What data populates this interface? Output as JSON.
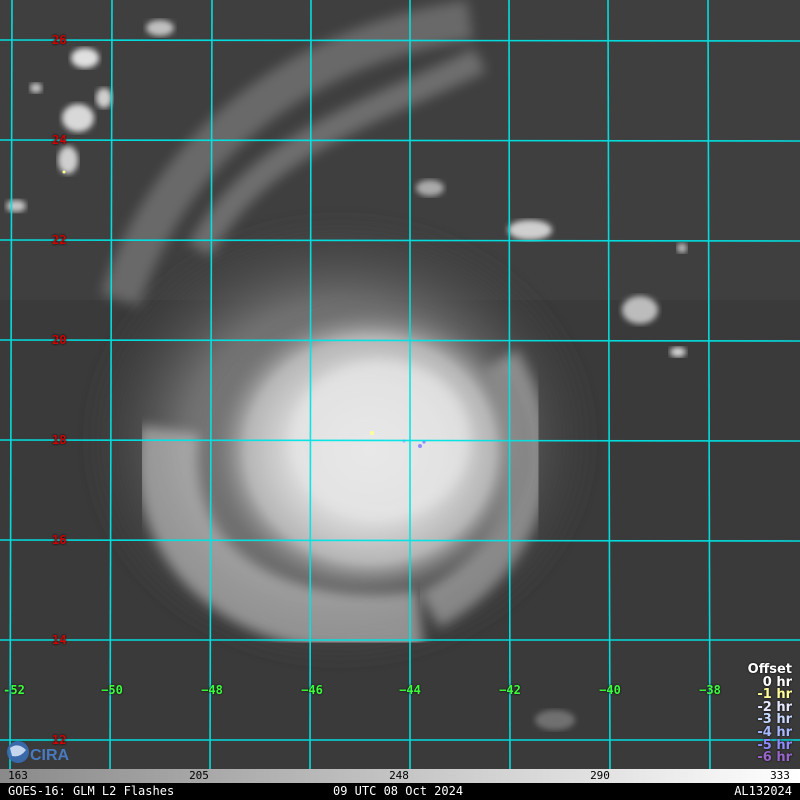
{
  "map": {
    "lat_labels": [
      "26",
      "24",
      "22",
      "20",
      "18",
      "16",
      "14",
      "12"
    ],
    "lon_labels": [
      "-52",
      "−50",
      "−48",
      "−46",
      "−44",
      "−42",
      "−40",
      "−38"
    ],
    "grid_color": "#00e5e5",
    "lat_label_color": "#d40000",
    "lon_label_color": "#3cff3c"
  },
  "offset_legend": {
    "title": "Offset",
    "items": [
      {
        "label": "0 hr",
        "color": "#ffffff"
      },
      {
        "label": "-1 hr",
        "color": "#ffff99"
      },
      {
        "label": "-2 hr",
        "color": "#e8e8ff"
      },
      {
        "label": "-3 hr",
        "color": "#c8d8ff"
      },
      {
        "label": "-4 hr",
        "color": "#a8b8ff"
      },
      {
        "label": "-5 hr",
        "color": "#8c8cff"
      },
      {
        "label": "-6 hr",
        "color": "#9966cc"
      }
    ]
  },
  "colorbar": {
    "ticks": [
      "163",
      "205",
      "248",
      "290",
      "333"
    ]
  },
  "footer": {
    "left": "GOES-16: GLM L2 Flashes",
    "middle": "09 UTC 08 Oct 2024",
    "right": "AL132024"
  },
  "logo": {
    "text": "CIRA"
  }
}
